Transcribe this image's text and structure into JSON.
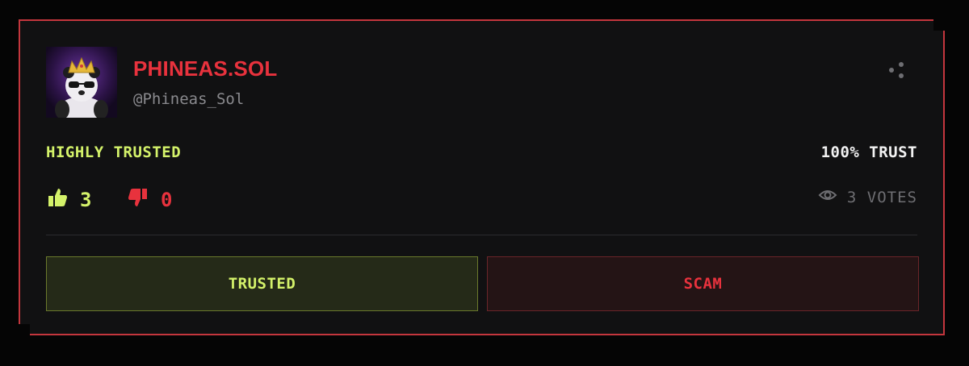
{
  "profile": {
    "name": "PHINEAS.SOL",
    "handle": "@Phineas_Sol"
  },
  "trust": {
    "status_label": "HIGHLY TRUSTED",
    "percent_label": "100% TRUST",
    "percent": 100
  },
  "votes": {
    "up_count": "3",
    "down_count": "0",
    "total_label": "3 VOTES"
  },
  "actions": {
    "trusted_label": "TRUSTED",
    "scam_label": "SCAM"
  },
  "icons": {
    "share": "share-icon",
    "thumbs_up": "thumbs-up-icon",
    "thumbs_down": "thumbs-down-icon",
    "eye": "eye-icon"
  },
  "colors": {
    "accent_red": "#e8323d",
    "accent_green": "#d4f26a",
    "card_border": "#c4363d",
    "background": "#111112"
  }
}
